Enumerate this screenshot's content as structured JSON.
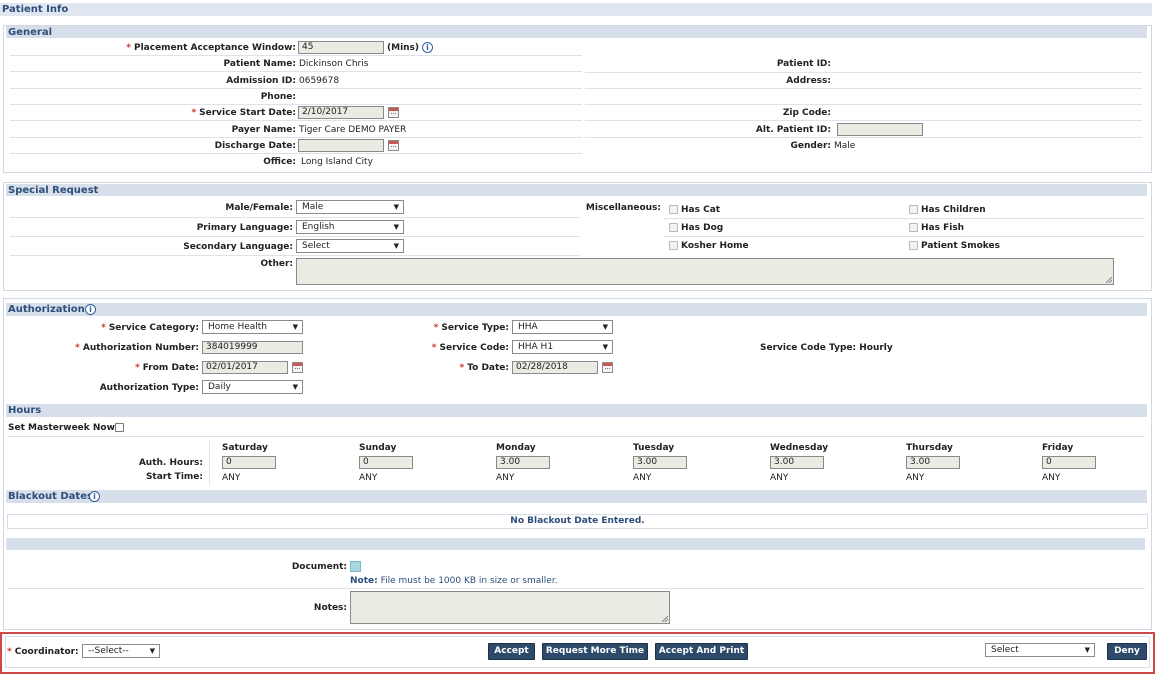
{
  "header": {
    "title": "Patient Info"
  },
  "general": {
    "title": "General",
    "placement_label": "Placement Acceptance Window:",
    "placement_value": "45",
    "placement_unit": "(Mins)",
    "patient_name_label": "Patient Name:",
    "patient_name": "Dickinson Chris",
    "admission_id_label": "Admission ID:",
    "admission_id": "0659678",
    "phone_label": "Phone:",
    "service_start_label": "Service Start Date:",
    "service_start": "2/10/2017",
    "payer_label": "Payer Name:",
    "payer": "Tiger Care DEMO PAYER",
    "discharge_label": "Discharge Date:",
    "discharge": "",
    "office_label": "Office:",
    "office": "Long Island City",
    "patient_id_label": "Patient ID:",
    "address_label": "Address:",
    "zip_label": "Zip Code:",
    "alt_patient_id_label": "Alt. Patient ID:",
    "alt_patient_id": "",
    "gender_label": "Gender:",
    "gender": "Male"
  },
  "special": {
    "title": "Special Request",
    "gender_pref_label": "Male/Female:",
    "gender_pref": "Male",
    "primary_lang_label": "Primary Language:",
    "primary_lang": "English",
    "secondary_lang_label": "Secondary Language:",
    "secondary_lang": "Select",
    "other_label": "Other:",
    "misc_label": "Miscellaneous:",
    "has_cat": "Has Cat",
    "has_dog": "Has Dog",
    "kosher": "Kosher Home",
    "has_children": "Has Children",
    "has_fish": "Has Fish",
    "smokes": "Patient Smokes"
  },
  "authorization": {
    "title": "Authorization",
    "service_category_label": "Service Category:",
    "service_category": "Home Health",
    "auth_number_label": "Authorization Number:",
    "auth_number": "384019999",
    "from_date_label": "From Date:",
    "from_date": "02/01/2017",
    "auth_type_label": "Authorization Type:",
    "auth_type": "Daily",
    "service_type_label": "Service Type:",
    "service_type": "HHA",
    "service_code_label": "Service Code:",
    "service_code": "HHA H1",
    "to_date_label": "To Date:",
    "to_date": "02/28/2018",
    "service_code_type": "Service Code Type: Hourly"
  },
  "hours": {
    "title": "Hours",
    "masterweek_label": "Set Masterweek Now:",
    "auth_hours_label": "Auth. Hours:",
    "start_time_label": "Start Time:",
    "days": [
      {
        "name": "Saturday",
        "hours": "0",
        "start": "ANY"
      },
      {
        "name": "Sunday",
        "hours": "0",
        "start": "ANY"
      },
      {
        "name": "Monday",
        "hours": "3.00",
        "start": "ANY"
      },
      {
        "name": "Tuesday",
        "hours": "3.00",
        "start": "ANY"
      },
      {
        "name": "Wednesday",
        "hours": "3.00",
        "start": "ANY"
      },
      {
        "name": "Thursday",
        "hours": "3.00",
        "start": "ANY"
      },
      {
        "name": "Friday",
        "hours": "0",
        "start": "ANY"
      }
    ]
  },
  "blackout": {
    "title": "Blackout Dates",
    "empty_message": "No Blackout Date Entered."
  },
  "document": {
    "label": "Document:",
    "note_prefix": "Note:",
    "note_text": "File must be 1000 KB in size or smaller.",
    "notes_label": "Notes:"
  },
  "footer": {
    "coordinator_label": "Coordinator:",
    "coordinator_value": "--Select--",
    "accept": "Accept",
    "request_more_time": "Request More Time",
    "accept_and_print": "Accept And Print",
    "reason_select": "Select",
    "deny": "Deny"
  },
  "colors": {
    "section_bar": "#d6dfea",
    "section_title": "#2d4e7a",
    "button": "#2d4a6a",
    "required": "#d0302b",
    "highlight_border": "#d04845"
  }
}
